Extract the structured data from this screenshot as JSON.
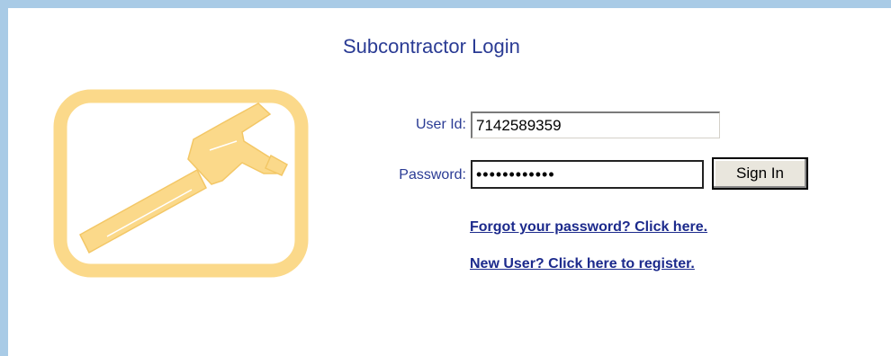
{
  "page": {
    "title": "Subcontractor Login"
  },
  "logo": {
    "icon": "hammer-icon",
    "color": "#fbd98a"
  },
  "form": {
    "user_id_label": "User Id:",
    "user_id_value": "7142589359",
    "password_label": "Password:",
    "password_value": "••••••••••••",
    "signin_label": "Sign In"
  },
  "links": {
    "forgot_password": "Forgot your password? Click here.",
    "register": "New User? Click here to register."
  },
  "colors": {
    "accent": "#2a3b94",
    "border": "#a9cbe6",
    "logo": "#fbd98a"
  }
}
